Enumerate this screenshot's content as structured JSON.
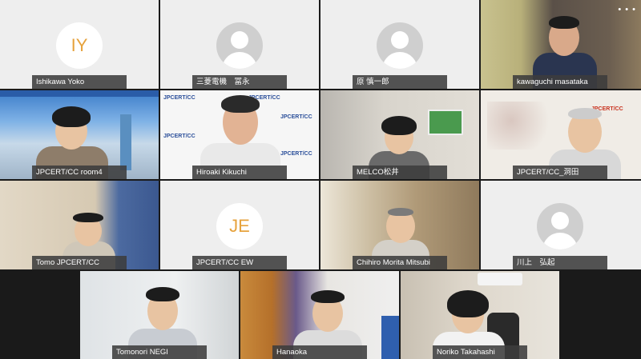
{
  "window": {
    "menu_glyph": "• • •"
  },
  "participants": [
    {
      "name": "Ishikawa Yoko",
      "initials": "IY"
    },
    {
      "name": "三菱電機　冨永"
    },
    {
      "name": "原 慎一郎"
    },
    {
      "name": "kawaguchi masataka"
    },
    {
      "name": "JPCERT/CC  room4"
    },
    {
      "name": "Hiroaki Kikuchi"
    },
    {
      "name": "MELCO松井"
    },
    {
      "name": "JPCERT/CC_洞田"
    },
    {
      "name": "Tomo JPCERT/CC"
    },
    {
      "name": "JPCERT/CC EW",
      "initials": "JE"
    },
    {
      "name": "Chihiro Morita Mitsubi"
    },
    {
      "name": "川上　弘起"
    },
    {
      "name": "Tomonori NEGI"
    },
    {
      "name": "Hanaoka"
    },
    {
      "name": "Noriko Takahashi"
    }
  ],
  "colors": {
    "initials_text": "#e6a23c",
    "tile_bg": "#eeeeee",
    "name_tag_bg": "#3c3c3c"
  },
  "branding": {
    "logo_text": "JPCERT/CC"
  }
}
